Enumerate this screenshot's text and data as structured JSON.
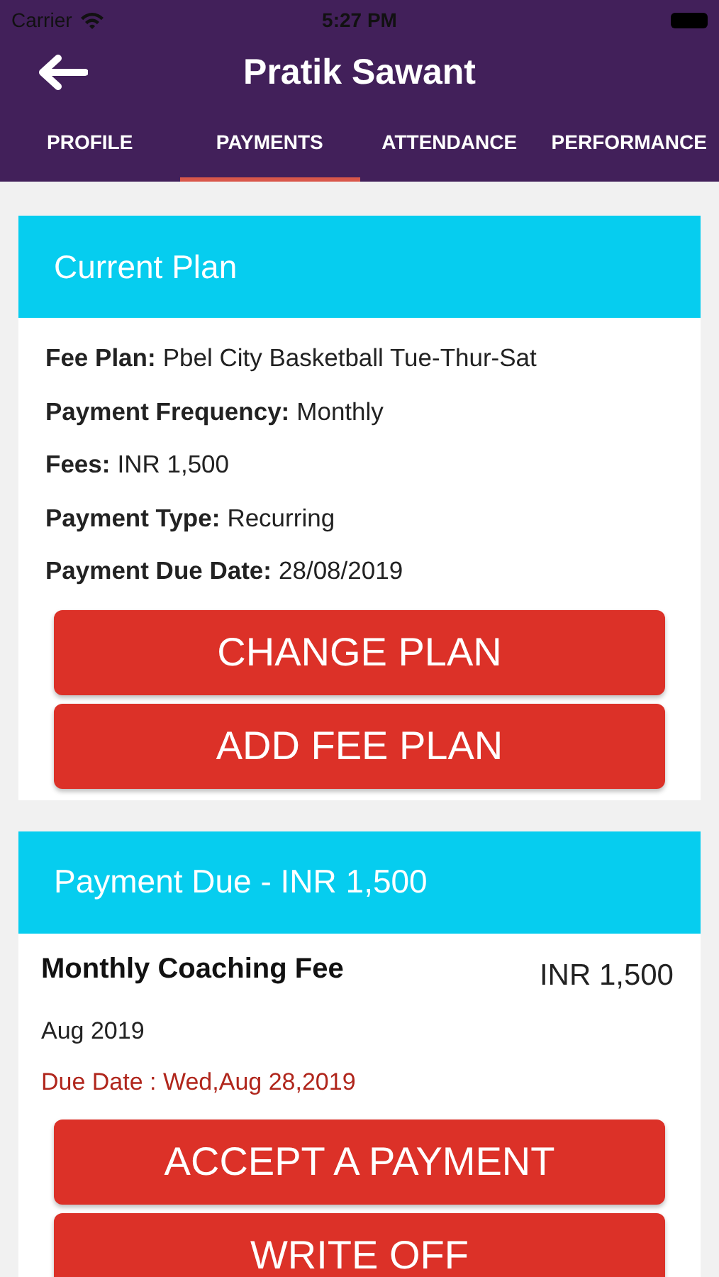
{
  "status_bar": {
    "carrier": "Carrier",
    "time": "5:27 PM"
  },
  "header": {
    "title": "Pratik Sawant"
  },
  "tabs": [
    {
      "label": "PROFILE",
      "selected": false
    },
    {
      "label": "PAYMENTS",
      "selected": true
    },
    {
      "label": "ATTENDANCE",
      "selected": false
    },
    {
      "label": "PERFORMANCE",
      "selected": false
    }
  ],
  "current_plan": {
    "title": "Current Plan",
    "fields": [
      {
        "label": "Fee Plan:",
        "value": " Pbel City Basketball Tue-Thur-Sat"
      },
      {
        "label": "Payment Frequency:",
        "value": "Monthly"
      },
      {
        "label": "Fees:",
        "value": "INR 1,500"
      },
      {
        "label": "Payment Type:",
        "value": "Recurring"
      },
      {
        "label": "Payment Due Date:",
        "value": "28/08/2019"
      }
    ],
    "buttons": [
      "CHANGE PLAN",
      "ADD FEE PLAN"
    ]
  },
  "payment_due": {
    "title": "Payment Due - INR 1,500",
    "item": {
      "name": "Monthly Coaching Fee",
      "amount": "INR 1,500",
      "period": "Aug 2019",
      "due_date": "Due Date : Wed,Aug 28,2019"
    },
    "buttons": [
      "ACCEPT A PAYMENT",
      "WRITE OFF"
    ]
  }
}
